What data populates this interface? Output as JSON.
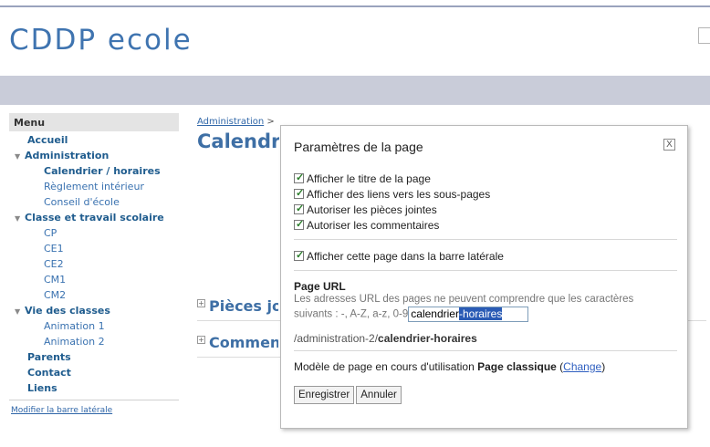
{
  "site": {
    "title": "CDDP ecole"
  },
  "sidebar": {
    "heading": "Menu",
    "items": [
      {
        "label": "Accueil",
        "level": 0,
        "expandable": false
      },
      {
        "label": "Administration",
        "level": 0,
        "expandable": true
      },
      {
        "label": "Calendrier / horaires",
        "level": 1,
        "active": true
      },
      {
        "label": "Règlement intérieur",
        "level": 1
      },
      {
        "label": "Conseil d'école",
        "level": 1
      },
      {
        "label": "Classe et travail scolaire",
        "level": 0,
        "expandable": true
      },
      {
        "label": "CP",
        "level": 1
      },
      {
        "label": "CE1",
        "level": 1
      },
      {
        "label": "CE2",
        "level": 1
      },
      {
        "label": "CM1",
        "level": 1
      },
      {
        "label": "CM2",
        "level": 1
      },
      {
        "label": "Vie des classes",
        "level": 0,
        "expandable": true
      },
      {
        "label": "Animation 1",
        "level": 1
      },
      {
        "label": "Animation 2",
        "level": 1
      },
      {
        "label": "Parents",
        "level": 0,
        "expandable": false
      },
      {
        "label": "Contact",
        "level": 0,
        "expandable": false
      },
      {
        "label": "Liens",
        "level": 0,
        "expandable": false
      }
    ],
    "edit_link": "Modifier la barre latérale"
  },
  "main": {
    "breadcrumb_link": "Administration",
    "breadcrumb_sep": ">",
    "page_title": "Calendrier / horaires",
    "sections": [
      "Pièces jointes",
      "Commentaires"
    ]
  },
  "dialog": {
    "title": "Paramètres de la page",
    "close_label": "X",
    "options": [
      {
        "label": "Afficher le titre de la page",
        "checked": true
      },
      {
        "label": "Afficher des liens vers les sous-pages",
        "checked": true
      },
      {
        "label": "Autoriser les pièces jointes",
        "checked": true
      },
      {
        "label": "Autoriser les commentaires",
        "checked": true
      }
    ],
    "sidebar_option": {
      "label": "Afficher cette page dans la barre latérale",
      "checked": true
    },
    "url": {
      "title": "Page URL",
      "description_1": "Les adresses URL des pages ne peuvent comprendre que les caractères",
      "description_2": "suivants : -, A-Z, a-z, 0-9",
      "value_plain": "calendrier",
      "value_selected": "-horaires",
      "path_prefix": "/administration-2/",
      "path_slug": "calendrier-horaires"
    },
    "template": {
      "prefix": "Modèle de page en cours d'utilisation",
      "name": "Page classique",
      "change_link": "Change"
    },
    "buttons": {
      "save": "Enregistrer",
      "cancel": "Annuler"
    }
  }
}
